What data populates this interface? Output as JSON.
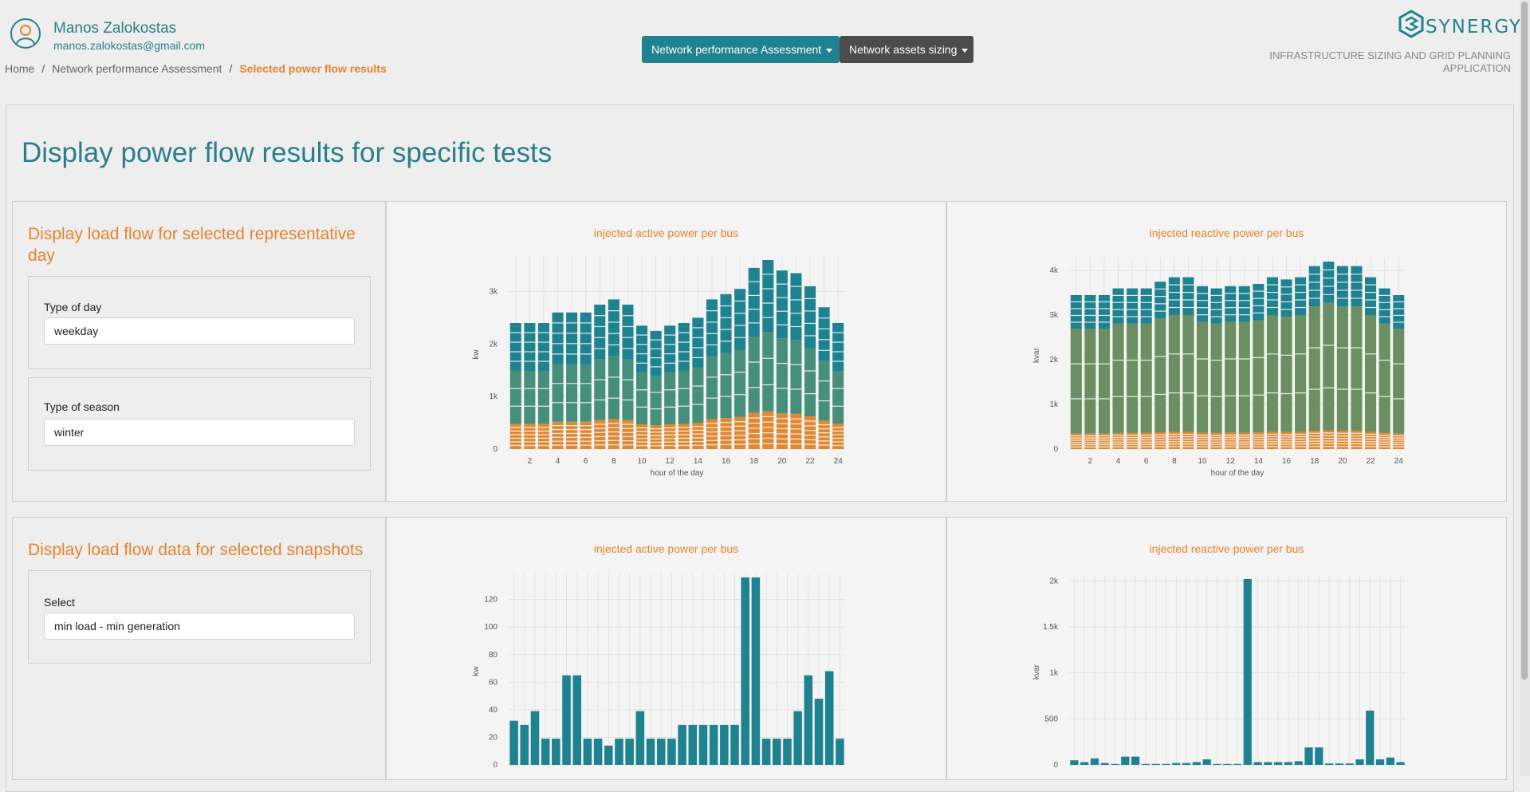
{
  "user": {
    "name": "Manos Zalokostas",
    "email": "manos.zalokostas@gmail.com"
  },
  "breadcrumb": {
    "home": "Home",
    "section": "Network performance Assessment",
    "current": "Selected power flow results",
    "separator": "/"
  },
  "nav": {
    "performance": "Network performance Assessment",
    "sizing": "Network assets sizing"
  },
  "brand": {
    "name": "SYNERGY",
    "subtitle": "INFRASTRUCTURE SIZING AND GRID PLANNING APPLICATION"
  },
  "page": {
    "title": "Display power flow results for specific tests"
  },
  "representative_day": {
    "title": "Display load flow for selected representative day",
    "type_of_day_label": "Type of day",
    "type_of_day_value": "weekday",
    "type_of_season_label": "Type of season",
    "type_of_season_value": "winter"
  },
  "snapshots": {
    "title": "Display load flow data for selected snapshots",
    "select_label": "Select",
    "select_value": "min load - min generation"
  },
  "colors": {
    "teal": "#1f8290",
    "mid_green": "#468f7a",
    "green": "#6b8f62",
    "orange": "#df8934",
    "accent": "#e8822c"
  },
  "chart_data": [
    {
      "type": "bar",
      "stacked": true,
      "title": "injected active power per bus",
      "xlabel": "hour of the day",
      "ylabel": "kw",
      "x": [
        1,
        2,
        3,
        4,
        5,
        6,
        7,
        8,
        9,
        10,
        11,
        12,
        13,
        14,
        15,
        16,
        17,
        18,
        19,
        20,
        21,
        22,
        23,
        24
      ],
      "x_ticks": [
        "2",
        "4",
        "6",
        "8",
        "10",
        "12",
        "14",
        "16",
        "18",
        "20",
        "22",
        "24"
      ],
      "y_ticks": [
        "0",
        "1k",
        "2k",
        "3k"
      ],
      "ylim": [
        0,
        3600
      ],
      "values": [
        2400,
        2400,
        2400,
        2600,
        2600,
        2600,
        2750,
        2850,
        2750,
        2350,
        2250,
        2350,
        2400,
        2500,
        2850,
        2950,
        3050,
        3450,
        3600,
        3400,
        3350,
        3100,
        2700,
        2400
      ],
      "composition": {
        "orange": 0.2,
        "mid_green": 0.42,
        "teal": 0.38
      }
    },
    {
      "type": "bar",
      "stacked": true,
      "title": "injected reactive power per bus",
      "xlabel": "hour of the day",
      "ylabel": "kvar",
      "x": [
        1,
        2,
        3,
        4,
        5,
        6,
        7,
        8,
        9,
        10,
        11,
        12,
        13,
        14,
        15,
        16,
        17,
        18,
        19,
        20,
        21,
        22,
        23,
        24
      ],
      "x_ticks": [
        "2",
        "4",
        "6",
        "8",
        "10",
        "12",
        "14",
        "16",
        "18",
        "20",
        "22",
        "24"
      ],
      "y_ticks": [
        "0",
        "1k",
        "2k",
        "3k",
        "4k"
      ],
      "ylim": [
        0,
        4200
      ],
      "values": [
        3450,
        3450,
        3450,
        3600,
        3600,
        3600,
        3750,
        3850,
        3850,
        3650,
        3600,
        3650,
        3650,
        3700,
        3850,
        3800,
        3850,
        4100,
        4200,
        4100,
        4100,
        3850,
        3600,
        3450
      ],
      "composition": {
        "orange": 0.1,
        "green": 0.68,
        "teal": 0.22
      }
    },
    {
      "type": "bar",
      "title": "injected active power per bus",
      "ylabel": "kw",
      "y_ticks": [
        "0",
        "20",
        "40",
        "60",
        "80",
        "100",
        "120"
      ],
      "ylim": [
        0,
        136
      ],
      "values": [
        32,
        29,
        39,
        19,
        19,
        65,
        65,
        19,
        19,
        14,
        19,
        19,
        39,
        19,
        19,
        19,
        29,
        29,
        29,
        29,
        29,
        29,
        136,
        136,
        19,
        19,
        19,
        39,
        65,
        48,
        68,
        19
      ]
    },
    {
      "type": "bar",
      "title": "injected reactive power per bus",
      "ylabel": "kvar",
      "y_ticks": [
        "0",
        "500",
        "1k",
        "1.5k",
        "2k"
      ],
      "ylim": [
        0,
        2020
      ],
      "values": [
        50,
        30,
        70,
        20,
        10,
        90,
        90,
        10,
        10,
        10,
        20,
        20,
        30,
        60,
        10,
        10,
        10,
        2020,
        30,
        30,
        30,
        30,
        40,
        190,
        190,
        15,
        15,
        15,
        60,
        590,
        60,
        80,
        30
      ]
    }
  ]
}
